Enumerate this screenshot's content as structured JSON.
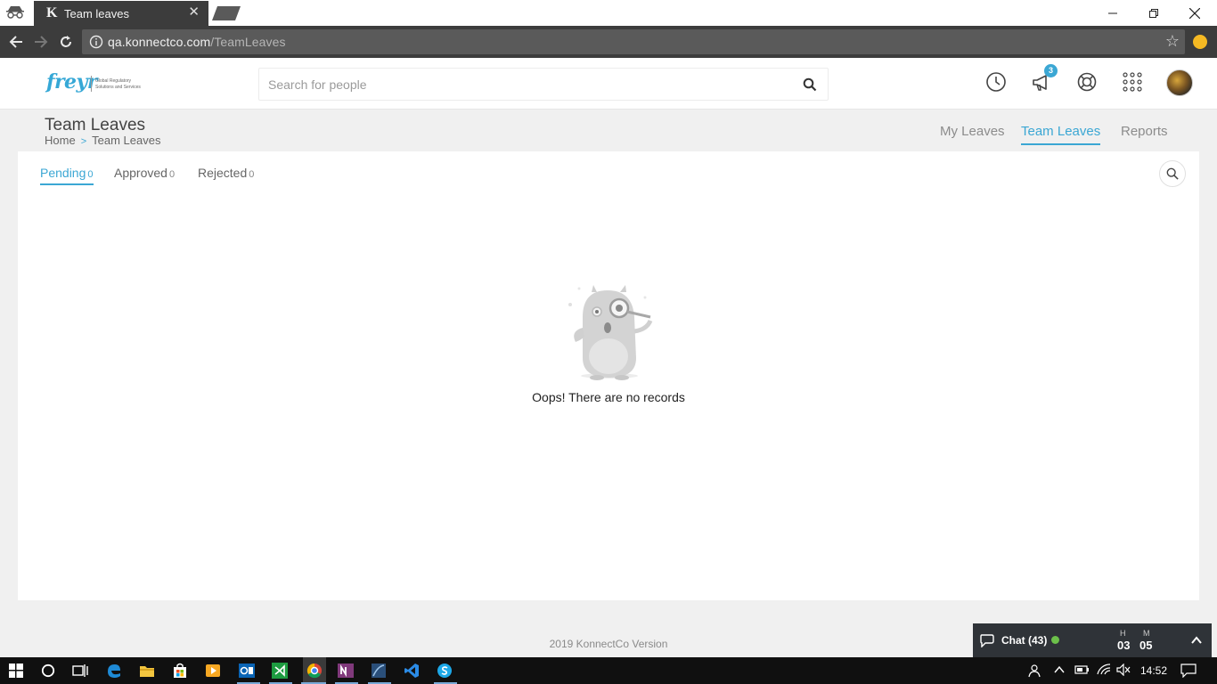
{
  "browser": {
    "tab_title": "Team leaves",
    "tab_favicon": "K",
    "url_host": "qa.konnectco.com",
    "url_path": "/TeamLeaves"
  },
  "header": {
    "logo_text": "freyr",
    "logo_sub1": "Global Regulatory",
    "logo_sub2": "Solutions and Services",
    "search_placeholder": "Search for people",
    "notification_count": "3"
  },
  "page": {
    "title": "Team Leaves",
    "breadcrumb_home": "Home",
    "breadcrumb_current": "Team Leaves",
    "nav": [
      "My Leaves",
      "Team Leaves",
      "Reports"
    ]
  },
  "subtabs": [
    {
      "label": "Pending",
      "count": "0"
    },
    {
      "label": "Approved",
      "count": "0"
    },
    {
      "label": "Rejected",
      "count": "0"
    }
  ],
  "empty_message": "Oops! There are no records",
  "footer": "2019 KonnectCo Version",
  "chat": {
    "label": "Chat (43)",
    "h_label": "H",
    "h_value": "03",
    "m_label": "M",
    "m_value": "05"
  },
  "taskbar": {
    "time": "14:52"
  },
  "colors": {
    "accent": "#3ba7d4",
    "chat_bg": "#2f3338",
    "online": "#6cc04a"
  }
}
